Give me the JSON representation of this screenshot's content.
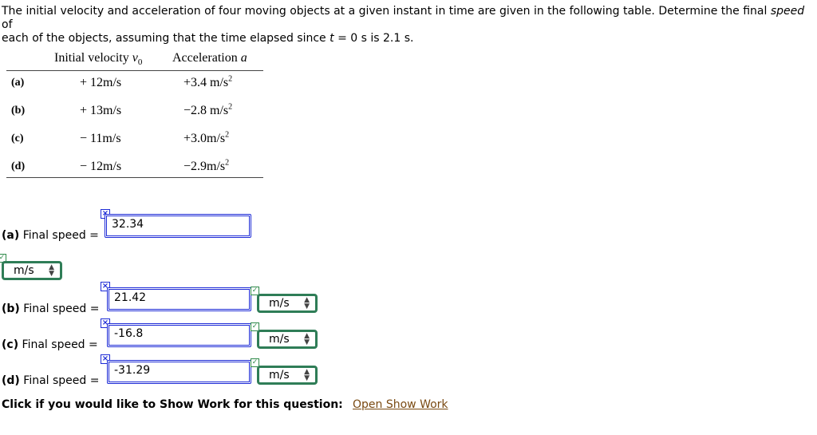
{
  "question": {
    "line1_a": "The initial velocity and acceleration of four moving objects at a given instant in time are given in the following table. Determine the final ",
    "line1_speed": "speed",
    "line1_b": " of",
    "line2_a": "each of the objects, assuming that the time elapsed since ",
    "line2_t": "t",
    "line2_b": " = 0 s is 2.1 s."
  },
  "table": {
    "header_velocity": "Initial velocity ",
    "header_velocity_sym": "v",
    "header_velocity_sub": "0",
    "header_accel": "Acceleration ",
    "header_accel_sym": "a",
    "rows": [
      {
        "label": "(a)",
        "velocity": "+ 12m/s",
        "accel": "+3.4 m/s",
        "accel_sup": "2"
      },
      {
        "label": "(b)",
        "velocity": "+ 13m/s",
        "accel": "−2.8 m/s",
        "accel_sup": "2"
      },
      {
        "label": "(c)",
        "velocity": "− 11m/s",
        "accel": "+3.0m/s",
        "accel_sup": "2"
      },
      {
        "label": "(d)",
        "velocity": "− 12m/s",
        "accel": "−2.9m/s",
        "accel_sup": "2"
      }
    ]
  },
  "answers": [
    {
      "prefix": "(a)",
      "text": " Final speed = ",
      "value": "32.34",
      "unit": "m/s"
    },
    {
      "prefix": "(b)",
      "text": " Final speed = ",
      "value": "21.42",
      "unit": "m/s"
    },
    {
      "prefix": "(c)",
      "text": " Final speed = ",
      "value": "-16.8",
      "unit": "m/s"
    },
    {
      "prefix": "(d)",
      "text": " Final speed = ",
      "value": "-31.29",
      "unit": "m/s"
    }
  ],
  "icons": {
    "incorrect": "×",
    "correct": "✓",
    "select_arrows": "▲▼"
  },
  "footer": {
    "show_work_text": "Click if you would like to Show Work for this question:",
    "show_work_link": "Open Show Work"
  },
  "colors": {
    "answer_border": "#1d2bd6",
    "unit_border": "#2f7d57",
    "link": "#7a4a12"
  }
}
